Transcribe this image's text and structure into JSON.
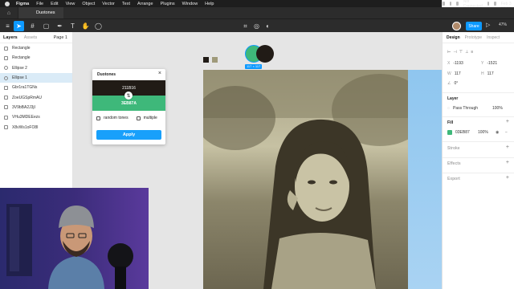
{
  "menubar": {
    "app": "Figma",
    "items": [
      "File",
      "Edit",
      "View",
      "Object",
      "Vector",
      "Text",
      "Arrange",
      "Plugins",
      "Window",
      "Help"
    ],
    "status": "Not Connected",
    "datetime": "Wed Feb 3  17:01"
  },
  "tabbar": {
    "tab_label": "Duotones"
  },
  "toolbar": {
    "share_label": "Share",
    "zoom": "47%"
  },
  "left_panel": {
    "tab_layers": "Layers",
    "tab_assets": "Assets",
    "page": "Page 1",
    "layers": [
      {
        "name": "Rectangle",
        "icon": "rect"
      },
      {
        "name": "Rectangle",
        "icon": "rect"
      },
      {
        "name": "Ellipse 2",
        "icon": "ellipse"
      },
      {
        "name": "Ellipse 1",
        "icon": "ellipse",
        "selected": true
      },
      {
        "name": "Gbr1ra1TGNs",
        "icon": "image"
      },
      {
        "name": "ZoeUGSpRmAU",
        "icon": "image"
      },
      {
        "name": "3V9bBA2J3jI",
        "icon": "image"
      },
      {
        "name": "VHu3MDEEezs",
        "icon": "image"
      },
      {
        "name": "X8vWs1oFO8I",
        "icon": "image"
      }
    ]
  },
  "canvas": {
    "selection_size": "117 × 117",
    "colors": {
      "dark": "#211B16",
      "green": "#3EB87A",
      "tan": "#9F9A7A",
      "blue": "#8FC6EF"
    }
  },
  "plugin": {
    "title": "Duotones",
    "color1": "211B16",
    "color2": "3EB87A",
    "opt_random": "random tones",
    "opt_multiple": "multiple",
    "apply": "Apply"
  },
  "right_panel": {
    "tab_design": "Design",
    "tab_prototype": "Prototype",
    "tab_inspect": "Inspect",
    "x": "-1193",
    "y": "-1521",
    "w": "117",
    "h": "117",
    "rotation": "0°",
    "layer_title": "Layer",
    "blend": "Pass Through",
    "layer_opacity": "100%",
    "fill_title": "Fill",
    "fill_hex": "03EB87",
    "fill_opacity": "100%",
    "stroke_title": "Stroke",
    "effects_title": "Effects",
    "export_title": "Export"
  }
}
